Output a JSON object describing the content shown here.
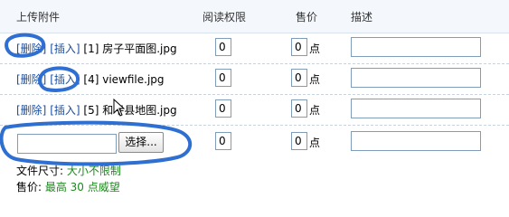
{
  "header": {
    "attachments": "上传附件",
    "read_permission": "阅读权限",
    "price": "售价",
    "description": "描述"
  },
  "rows": [
    {
      "delete_label": "[删除]",
      "insert_label": "[插入]",
      "filename": "[1] 房子平面图.jpg",
      "permission": "0",
      "price": "0",
      "unit": "点"
    },
    {
      "delete_label": "[删除]",
      "insert_label": "[插入]",
      "filename": "[4] viewfile.jpg",
      "permission": "0",
      "price": "0",
      "unit": "点"
    },
    {
      "delete_label": "[删除]",
      "insert_label": "[插入]",
      "filename": "[5] 和平县地图.jpg",
      "permission": "0",
      "price": "0",
      "unit": "点"
    }
  ],
  "upload_row": {
    "browse_label": "选择...",
    "permission": "0",
    "price": "0",
    "unit": "点"
  },
  "info": {
    "size_label": "文件尺寸: ",
    "size_value": "大小不限制",
    "price_label": "售价: ",
    "price_value": "最高 30 点威望"
  },
  "colors": {
    "link": "#1b4e9b",
    "highlight": "#1a8a1a",
    "annotation": "#2f6fd1"
  }
}
